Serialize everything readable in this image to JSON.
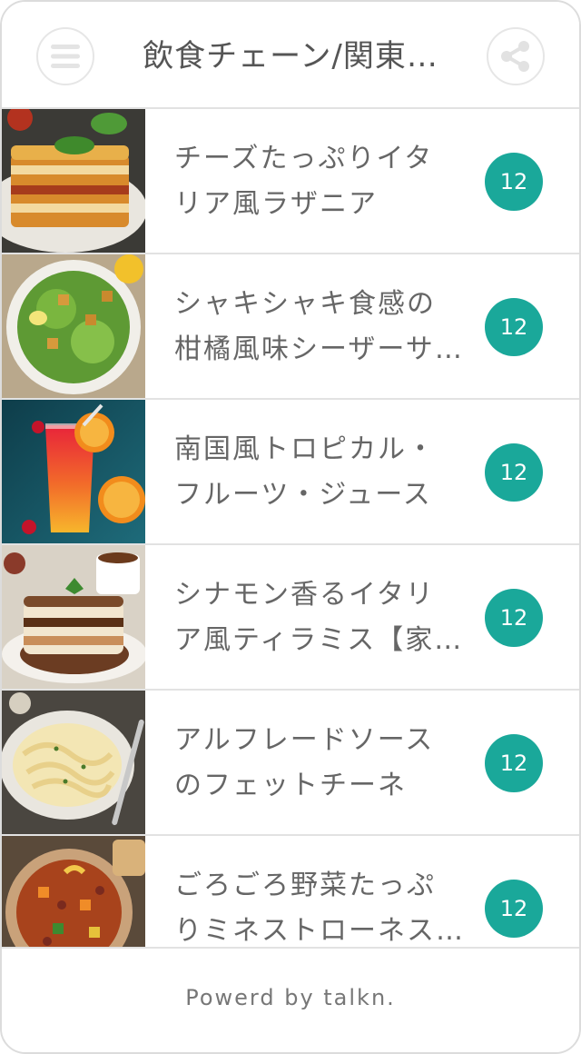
{
  "header": {
    "title": "飲食チェーン/関東…",
    "menu_icon": "hamburger-menu-icon",
    "share_icon": "share-icon"
  },
  "items": [
    {
      "title_line1": "チーズたっぷりイタ",
      "title_line2": "リア風ラザニア",
      "count": "12",
      "thumb": "lasagna"
    },
    {
      "title_line1": "シャキシャキ食感の",
      "title_line2": "柑橘風味シーザーサ…",
      "count": "12",
      "thumb": "caesar-salad"
    },
    {
      "title_line1": "南国風トロピカル・",
      "title_line2": "フルーツ・ジュース",
      "count": "12",
      "thumb": "tropical-juice"
    },
    {
      "title_line1": "シナモン香るイタリ",
      "title_line2": "ア風ティラミス【家…",
      "count": "12",
      "thumb": "tiramisu"
    },
    {
      "title_line1": "アルフレードソース",
      "title_line2": "のフェットチーネ",
      "count": "12",
      "thumb": "fettuccine"
    },
    {
      "title_line1": "ごろごろ野菜たっぷ",
      "title_line2": "りミネストローネス…",
      "count": "12",
      "thumb": "minestrone"
    }
  ],
  "footer": {
    "powered": "Powerd by talkn."
  },
  "colors": {
    "badge": "#1aa89a",
    "border": "#e2e2e2",
    "text": "#666666"
  }
}
